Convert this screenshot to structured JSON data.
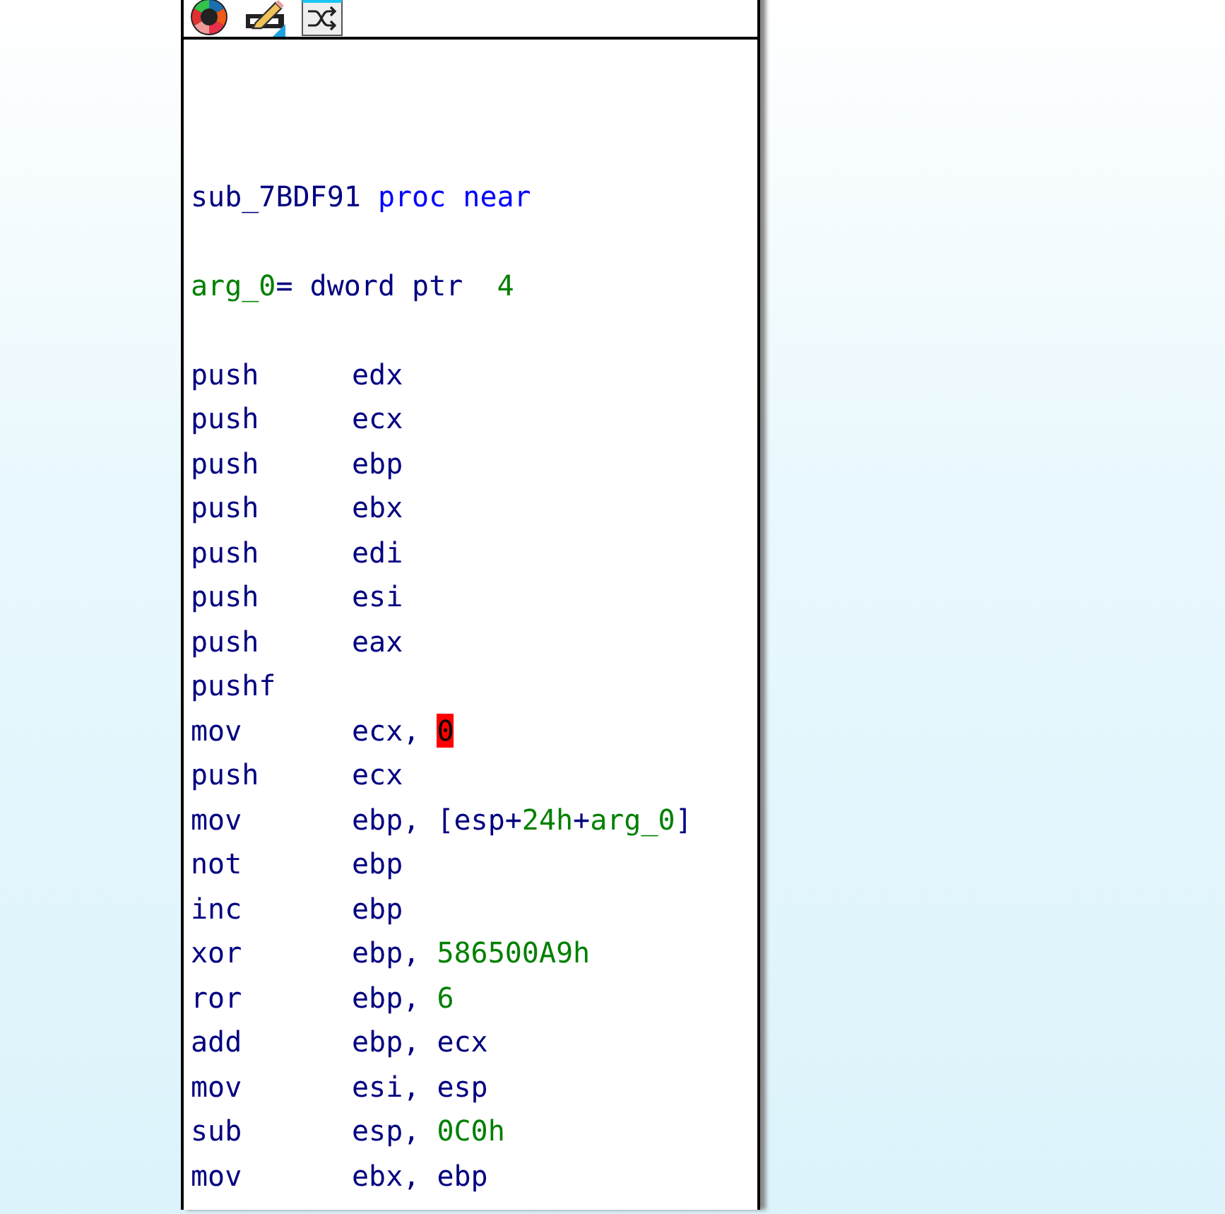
{
  "toolbar": {
    "buttons": [
      {
        "kind": "palette"
      },
      {
        "kind": "pencil"
      },
      {
        "kind": "shuffle"
      }
    ]
  },
  "listing": [
    {
      "kind": "blank"
    },
    {
      "kind": "blank"
    },
    {
      "kind": "blank"
    },
    {
      "kind": "text",
      "parts": [
        {
          "text": "sub_7BDF91 ",
          "kind": "name"
        },
        {
          "text": "proc near",
          "kind": "keyword"
        }
      ]
    },
    {
      "kind": "blank"
    },
    {
      "kind": "text",
      "parts": [
        {
          "text": "arg_0",
          "kind": "number"
        },
        {
          "text": "= dword ptr  ",
          "kind": "name"
        },
        {
          "text": "4",
          "kind": "number"
        }
      ]
    },
    {
      "kind": "blank"
    },
    {
      "kind": "insn",
      "mnemonic": "push",
      "parts": [
        {
          "text": "edx",
          "kind": "reg"
        }
      ]
    },
    {
      "kind": "insn",
      "mnemonic": "push",
      "parts": [
        {
          "text": "ecx",
          "kind": "reg"
        }
      ]
    },
    {
      "kind": "insn",
      "mnemonic": "push",
      "parts": [
        {
          "text": "ebp",
          "kind": "reg"
        }
      ]
    },
    {
      "kind": "insn",
      "mnemonic": "push",
      "parts": [
        {
          "text": "ebx",
          "kind": "reg"
        }
      ]
    },
    {
      "kind": "insn",
      "mnemonic": "push",
      "parts": [
        {
          "text": "edi",
          "kind": "reg"
        }
      ]
    },
    {
      "kind": "insn",
      "mnemonic": "push",
      "parts": [
        {
          "text": "esi",
          "kind": "reg"
        }
      ]
    },
    {
      "kind": "insn",
      "mnemonic": "push",
      "parts": [
        {
          "text": "eax",
          "kind": "reg"
        }
      ]
    },
    {
      "kind": "insn",
      "mnemonic": "pushf"
    },
    {
      "kind": "insn",
      "mnemonic": "mov",
      "parts": [
        {
          "text": "ecx, ",
          "kind": "reg"
        },
        {
          "text": "0",
          "kind": "plain",
          "highlighted": true
        }
      ]
    },
    {
      "kind": "insn",
      "mnemonic": "push",
      "parts": [
        {
          "text": "ecx",
          "kind": "reg"
        }
      ]
    },
    {
      "kind": "insn",
      "mnemonic": "mov",
      "parts": [
        {
          "text": "ebp, [esp+",
          "kind": "reg"
        },
        {
          "text": "24h",
          "kind": "number"
        },
        {
          "text": "+",
          "kind": "reg"
        },
        {
          "text": "arg_0",
          "kind": "number"
        },
        {
          "text": "]",
          "kind": "reg"
        }
      ]
    },
    {
      "kind": "insn",
      "mnemonic": "not",
      "parts": [
        {
          "text": "ebp",
          "kind": "reg"
        }
      ]
    },
    {
      "kind": "insn",
      "mnemonic": "inc",
      "parts": [
        {
          "text": "ebp",
          "kind": "reg"
        }
      ]
    },
    {
      "kind": "insn",
      "mnemonic": "xor",
      "parts": [
        {
          "text": "ebp, ",
          "kind": "reg"
        },
        {
          "text": "586500A9h",
          "kind": "number"
        }
      ]
    },
    {
      "kind": "insn",
      "mnemonic": "ror",
      "parts": [
        {
          "text": "ebp, ",
          "kind": "reg"
        },
        {
          "text": "6",
          "kind": "number"
        }
      ]
    },
    {
      "kind": "insn",
      "mnemonic": "add",
      "parts": [
        {
          "text": "ebp, ecx",
          "kind": "reg"
        }
      ]
    },
    {
      "kind": "insn",
      "mnemonic": "mov",
      "parts": [
        {
          "text": "esi, esp",
          "kind": "reg"
        }
      ]
    },
    {
      "kind": "insn",
      "mnemonic": "sub",
      "parts": [
        {
          "text": "esp, ",
          "kind": "reg"
        },
        {
          "text": "0C0h",
          "kind": "number"
        }
      ]
    },
    {
      "kind": "insn",
      "mnemonic": "mov",
      "parts": [
        {
          "text": "ebx, ebp",
          "kind": "reg"
        }
      ]
    }
  ]
}
